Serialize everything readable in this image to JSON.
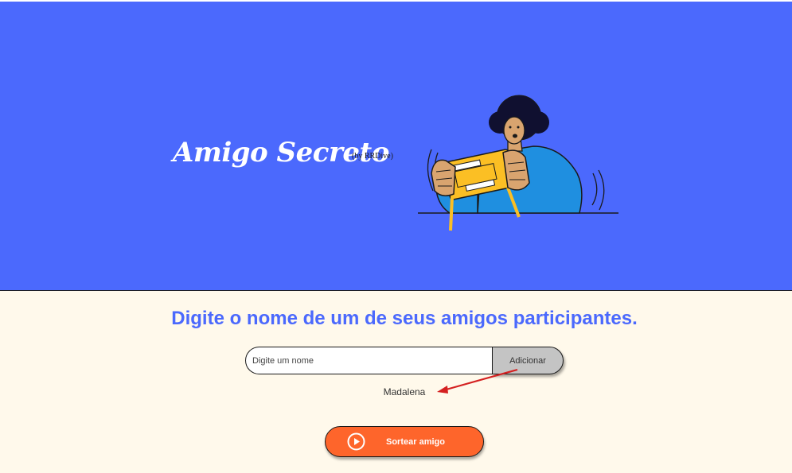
{
  "header": {
    "title": "Amigo Secreto",
    "byline": "(by RRDive)",
    "illustration_icon": "person-playing-handheld-console-illustration"
  },
  "main": {
    "subtitle": "Digite o nome de um de seus amigos participantes.",
    "name_input": {
      "placeholder": "Digite um nome",
      "value": ""
    },
    "add_button_label": "Adicionar",
    "friends": [
      "Madalena"
    ],
    "draw_button_label": "Sortear amigo",
    "draw_button_icon": "play-circle-icon"
  },
  "colors": {
    "hero_background": "#4b69fd",
    "page_background": "#fff9eb",
    "accent_blue": "#4b69fd",
    "add_button": "#c4c4c4",
    "draw_button": "#fe652b",
    "annotation_arrow": "#d42020"
  }
}
